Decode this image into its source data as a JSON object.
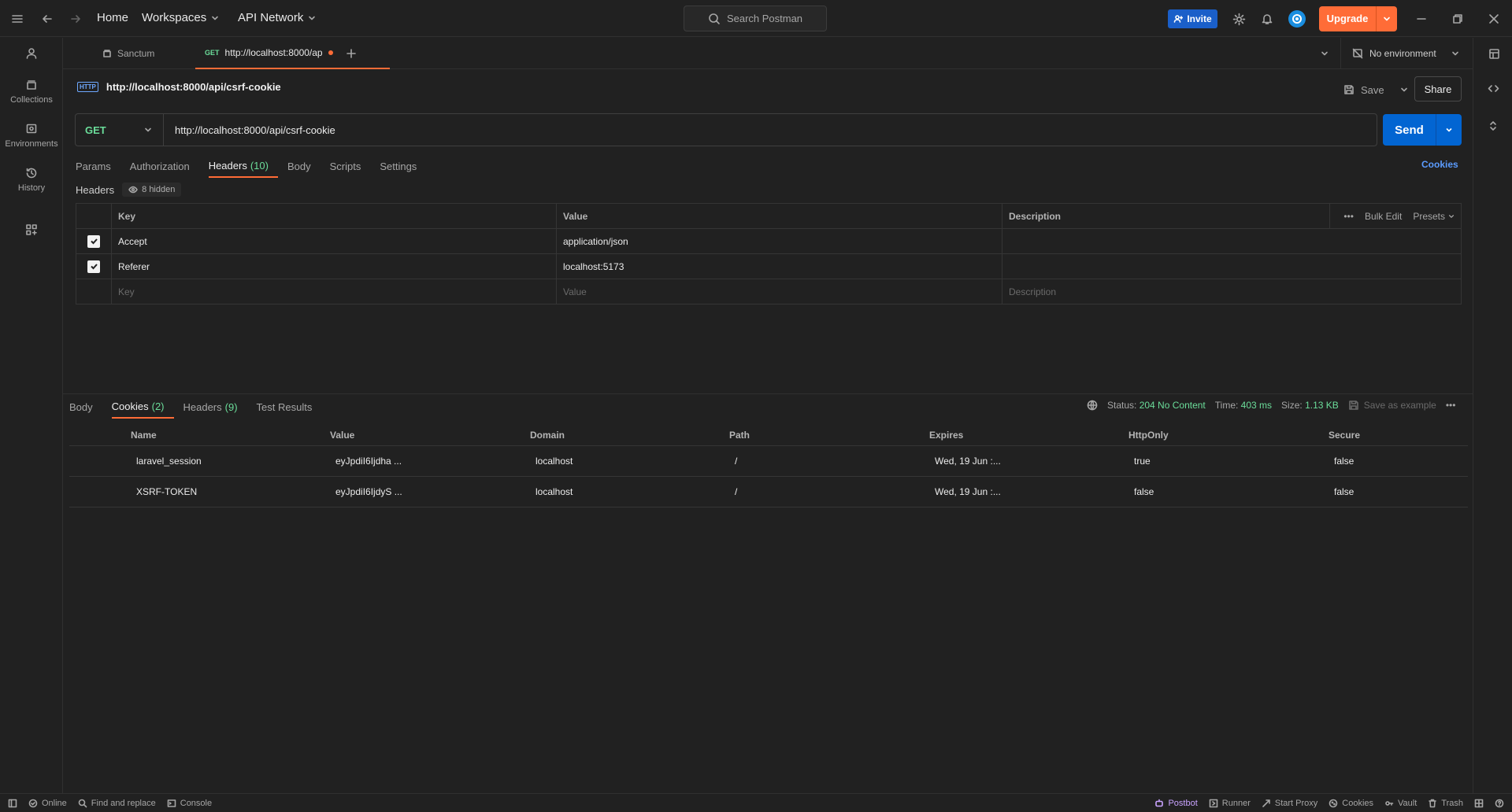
{
  "topbar": {
    "home": "Home",
    "workspaces": "Workspaces",
    "api_network": "API Network",
    "search_placeholder": "Search Postman",
    "invite": "Invite",
    "upgrade": "Upgrade"
  },
  "sidebar": {
    "items": [
      {
        "label": "Collections",
        "icon": "collections-icon"
      },
      {
        "label": "Environments",
        "icon": "environments-icon"
      },
      {
        "label": "History",
        "icon": "history-icon"
      }
    ]
  },
  "tabs": {
    "items": [
      {
        "label": "Sanctum"
      },
      {
        "method": "GET",
        "label": "http://localhost:8000/ap"
      }
    ],
    "environment": "No environment"
  },
  "request": {
    "title": "http://localhost:8000/api/csrf-cookie",
    "save": "Save",
    "share": "Share",
    "method": "GET",
    "url": "http://localhost:8000/api/csrf-cookie",
    "send": "Send",
    "tabs": {
      "params": "Params",
      "authorization": "Authorization",
      "headers": "Headers",
      "headers_count": "(10)",
      "body": "Body",
      "scripts": "Scripts",
      "settings": "Settings"
    },
    "cookies_link": "Cookies",
    "headers_label": "Headers",
    "hidden": "8 hidden",
    "table": {
      "col_key": "Key",
      "col_value": "Value",
      "col_description": "Description",
      "bulk_edit": "Bulk Edit",
      "presets": "Presets",
      "rows": [
        {
          "key": "Accept",
          "value": "application/json",
          "checked": true
        },
        {
          "key": "Referer",
          "value": "localhost:5173",
          "checked": true
        }
      ],
      "placeholder_key": "Key",
      "placeholder_value": "Value",
      "placeholder_description": "Description"
    }
  },
  "response": {
    "tabs": {
      "body": "Body",
      "cookies": "Cookies",
      "cookies_count": "(2)",
      "headers": "Headers",
      "headers_count": "(9)",
      "test_results": "Test Results"
    },
    "status_label": "Status:",
    "status_value": "204 No Content",
    "time_label": "Time:",
    "time_value": "403 ms",
    "size_label": "Size:",
    "size_value": "1.13 KB",
    "save_example": "Save as example",
    "cookie_columns": [
      "Name",
      "Value",
      "Domain",
      "Path",
      "Expires",
      "HttpOnly",
      "Secure"
    ],
    "cookies": [
      {
        "name": "laravel_session",
        "value": "eyJpdiI6Ijdha ...",
        "domain": "localhost",
        "path": "/",
        "expires": "Wed, 19 Jun :...",
        "httponly": "true",
        "secure": "false"
      },
      {
        "name": "XSRF-TOKEN",
        "value": "eyJpdiI6IjdyS ...",
        "domain": "localhost",
        "path": "/",
        "expires": "Wed, 19 Jun :...",
        "httponly": "false",
        "secure": "false"
      }
    ]
  },
  "statusbar": {
    "online": "Online",
    "find_replace": "Find and replace",
    "console": "Console",
    "postbot": "Postbot",
    "runner": "Runner",
    "start_proxy": "Start Proxy",
    "cookies": "Cookies",
    "vault": "Vault",
    "trash": "Trash"
  }
}
